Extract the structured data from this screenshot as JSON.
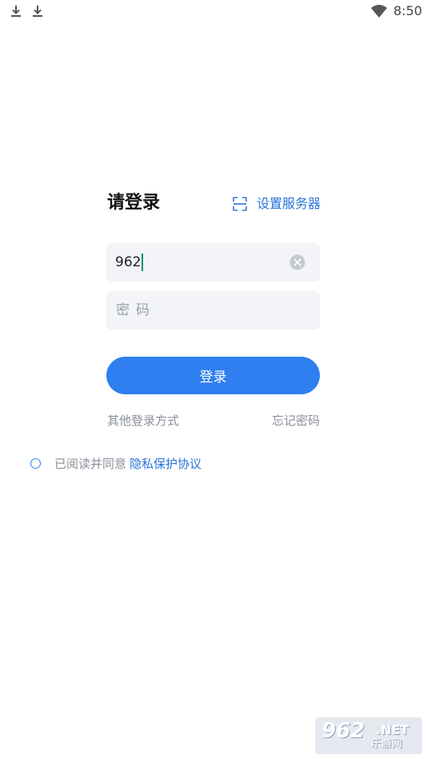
{
  "status_bar": {
    "time": "8:50",
    "icons": [
      "download-icon",
      "download-icon",
      "wifi-icon"
    ]
  },
  "login": {
    "title": "请登录",
    "server_link": {
      "icon": "scan-icon",
      "label": "设置服务器"
    },
    "account_field": {
      "value": "962",
      "clear_icon": "clear-icon"
    },
    "password_field": {
      "placeholder": "密码"
    },
    "login_button": "登录",
    "other_login": "其他登录方式",
    "forgot_password": "忘记密码",
    "agreement": {
      "text": "已阅读并同意",
      "link": "隐私保护协议"
    }
  },
  "watermark": {
    "number": "962",
    "domain": ".NET",
    "subtitle": "乐游网"
  },
  "colors": {
    "accent": "#2f7ff0",
    "link": "#2a73d9",
    "field_bg": "#f2f4f8",
    "muted_text": "#8a8f99"
  }
}
